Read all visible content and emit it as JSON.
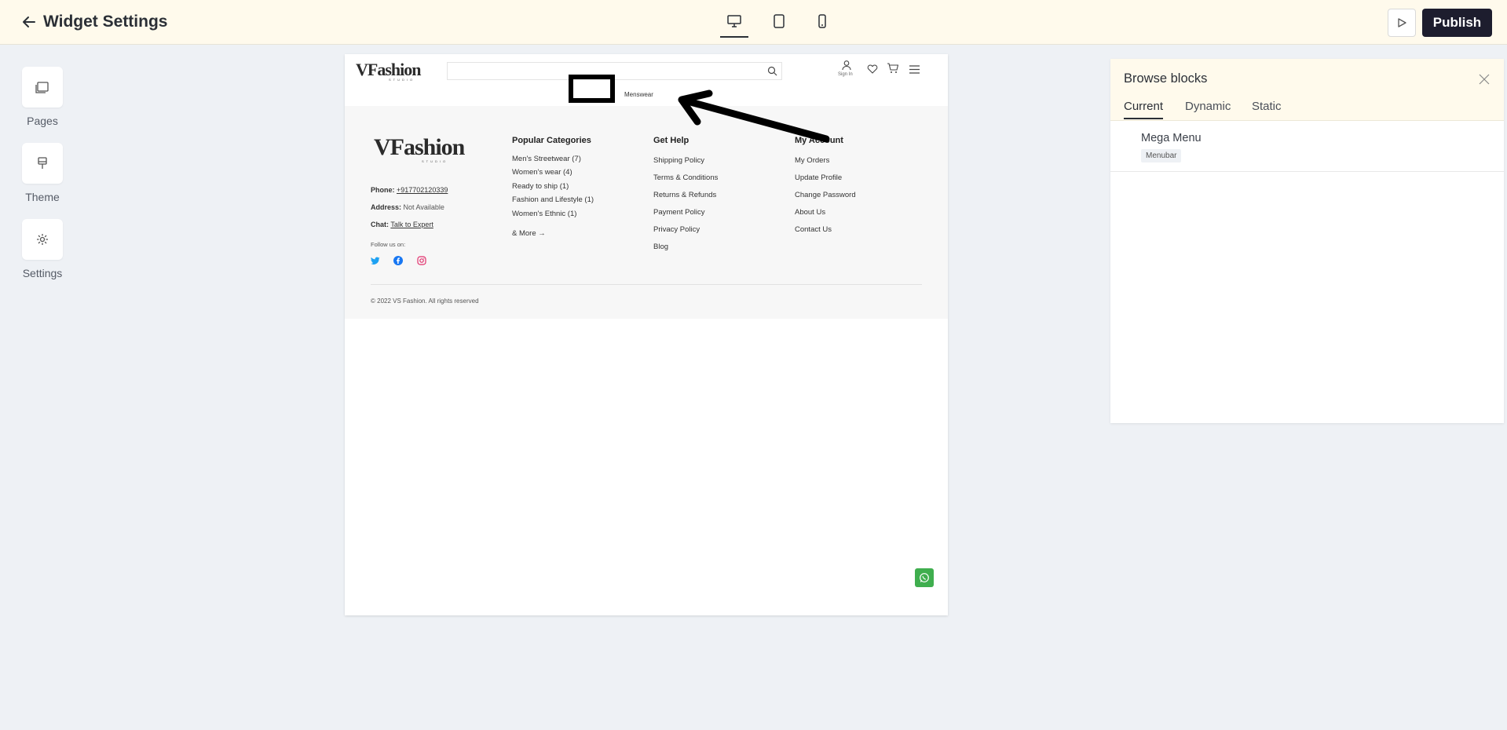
{
  "topbar": {
    "title": "Widget Settings",
    "devices": [
      "desktop-icon",
      "tablet-icon",
      "mobile-icon"
    ],
    "publish_label": "Publish"
  },
  "nav": {
    "pages": "Pages",
    "theme": "Theme",
    "settings": "Settings"
  },
  "site": {
    "logo_text": "VFashion",
    "logo_sub": "STUDIO",
    "signin": "Sign In",
    "menu_item": "Menswear",
    "footer": {
      "phone_label": "Phone:",
      "phone_value": "+917702120339",
      "address_label": "Address:",
      "address_value": "Not Available",
      "chat_label": "Chat:",
      "chat_value": "Talk to Expert",
      "follow": "Follow us on:",
      "popular_title": "Popular Categories",
      "popular": [
        "Men's Streetwear (7)",
        "Women's wear (4)",
        "Ready to ship (1)",
        "Fashion and Lifestyle (1)",
        "Women's Ethnic (1)"
      ],
      "more": "& More",
      "help_title": "Get Help",
      "help": [
        "Shipping Policy",
        "Terms & Conditions",
        "Returns & Refunds",
        "Payment Policy",
        "Privacy Policy",
        "Blog"
      ],
      "account_title": "My Account",
      "account": [
        "My Orders",
        "Update Profile",
        "Change Password",
        "About Us",
        "Contact Us"
      ],
      "copyright": "© 2022 VS Fashion. All rights reserved"
    }
  },
  "panel": {
    "title": "Browse blocks",
    "tabs": [
      "Current",
      "Dynamic",
      "Static"
    ],
    "block_name": "Mega Menu",
    "block_badge": "Menubar"
  },
  "colors": {
    "topbar_bg": "#fffaec",
    "publish_bg": "#1d1d2e",
    "page_bg": "#eef1f5",
    "whatsapp": "#3fae4e"
  }
}
